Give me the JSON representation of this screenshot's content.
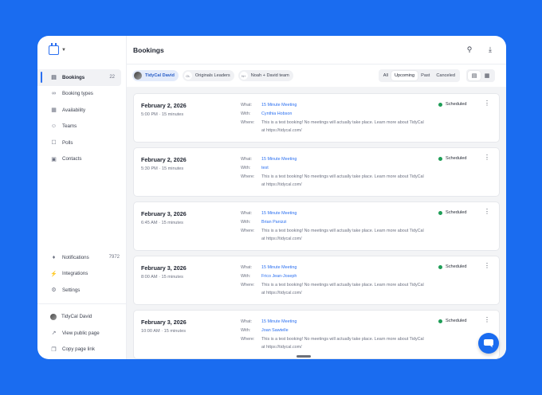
{
  "app": {
    "page_title": "Bookings"
  },
  "sidebar": {
    "items": [
      {
        "label": "Bookings",
        "count": "22",
        "icon": "calendar-icon"
      },
      {
        "label": "Booking types",
        "icon": "link-icon"
      },
      {
        "label": "Availability",
        "icon": "calendar-check-icon"
      },
      {
        "label": "Teams",
        "icon": "users-icon"
      },
      {
        "label": "Polls",
        "icon": "poll-icon"
      },
      {
        "label": "Contacts",
        "icon": "contact-card-icon"
      }
    ],
    "bottom": [
      {
        "label": "Notifications",
        "count": "7972",
        "icon": "bell-icon"
      },
      {
        "label": "Integrations",
        "icon": "plug-icon"
      },
      {
        "label": "Settings",
        "icon": "gear-icon"
      }
    ],
    "user": [
      {
        "label": "TidyCal David",
        "icon": "avatar"
      },
      {
        "label": "View public page",
        "icon": "external-link-icon"
      },
      {
        "label": "Copy page link",
        "icon": "copy-icon"
      }
    ]
  },
  "filters": {
    "chips": [
      {
        "label": "TidyCal David",
        "avatar": ""
      },
      {
        "label": "Originals Leaders",
        "avatar": "OL"
      },
      {
        "label": "Noah + David team",
        "avatar": "N+"
      }
    ],
    "tabs": [
      "All",
      "Upcoming",
      "Past",
      "Canceled"
    ],
    "active_tab": "Upcoming"
  },
  "labels": {
    "what": "What:",
    "with": "With:",
    "where": "Where:"
  },
  "bookings": [
    {
      "date": "February 2, 2026",
      "time": "5:00 PM",
      "duration": "15 minutes",
      "what": "15 Minute Meeting",
      "with": "Cynthia Hobson",
      "where": "This is a test booking! No meetings will actually take place. Learn more about TidyCal at https://tidycal.com/",
      "status": "Scheduled"
    },
    {
      "date": "February 2, 2026",
      "time": "5:30 PM",
      "duration": "15 minutes",
      "what": "15 Minute Meeting",
      "with": "test",
      "where": "This is a test booking! No meetings will actually take place. Learn more about TidyCal at https://tidycal.com/",
      "status": "Scheduled"
    },
    {
      "date": "February 3, 2026",
      "time": "6:45 AM",
      "duration": "15 minutes",
      "what": "15 Minute Meeting",
      "with": "Brian Panizzi",
      "where": "This is a test booking! No meetings will actually take place. Learn more about TidyCal at https://tidycal.com/",
      "status": "Scheduled"
    },
    {
      "date": "February 3, 2026",
      "time": "8:00 AM",
      "duration": "15 minutes",
      "what": "15 Minute Meeting",
      "with": "Frico Jean-Joseph",
      "where": "This is a test booking! No meetings will actually take place. Learn more about TidyCal at https://tidycal.com/",
      "status": "Scheduled"
    },
    {
      "date": "February 3, 2026",
      "time": "10:00 AM",
      "duration": "15 minutes",
      "what": "15 Minute Meeting",
      "with": "Joan Sawtelle",
      "where": "This is a test booking! No meetings will actually take place. Learn more about TidyCal at https://tidycal.com/",
      "status": "Scheduled"
    }
  ],
  "colors": {
    "accent": "#2a6ff0",
    "status_scheduled": "#1f9d57",
    "background": "#1a6cf0"
  }
}
